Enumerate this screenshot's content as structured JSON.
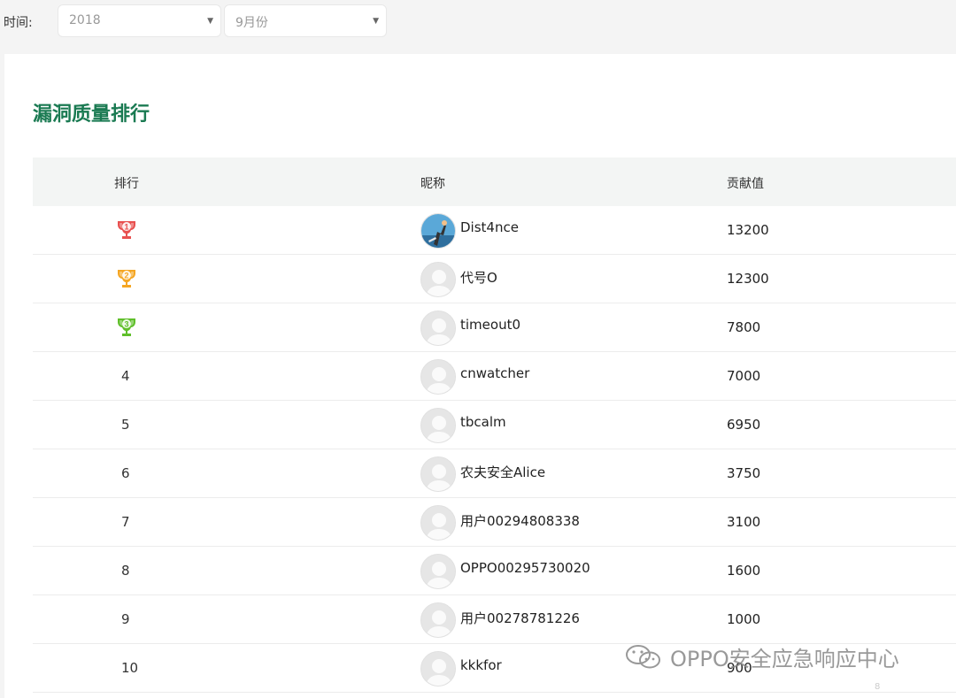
{
  "filter": {
    "label": "时间:",
    "year": "2018",
    "month": "9月份"
  },
  "section": {
    "title": "漏洞质量排行"
  },
  "table": {
    "headers": {
      "rank": "排行",
      "nickname": "昵称",
      "score": "贡献值"
    },
    "rows": [
      {
        "rank": "1",
        "nickname": "Dist4nce",
        "score": "13200",
        "trophy": "gold",
        "avatar": "photo"
      },
      {
        "rank": "2",
        "nickname": "代号O",
        "score": "12300",
        "trophy": "silver",
        "avatar": "default"
      },
      {
        "rank": "3",
        "nickname": "timeout0",
        "score": "7800",
        "trophy": "bronze",
        "avatar": "default"
      },
      {
        "rank": "4",
        "nickname": "cnwatcher",
        "score": "7000",
        "avatar": "default"
      },
      {
        "rank": "5",
        "nickname": "tbcalm",
        "score": "6950",
        "avatar": "default"
      },
      {
        "rank": "6",
        "nickname": "农夫安全Alice",
        "score": "3750",
        "avatar": "default"
      },
      {
        "rank": "7",
        "nickname": "用户00294808338",
        "score": "3100",
        "avatar": "default"
      },
      {
        "rank": "8",
        "nickname": "OPPO00295730020",
        "score": "1600",
        "avatar": "default"
      },
      {
        "rank": "9",
        "nickname": "用户00278781226",
        "score": "1000",
        "avatar": "default"
      },
      {
        "rank": "10",
        "nickname": "kkkfor",
        "score": "900",
        "avatar": "default"
      }
    ]
  },
  "watermark": {
    "text": "OPPO安全应急响应中心",
    "small": "8"
  },
  "colors": {
    "title": "#1a7a52",
    "trophy1": "#e8504f",
    "trophy2": "#f5a623",
    "trophy3": "#5fbf2a"
  }
}
